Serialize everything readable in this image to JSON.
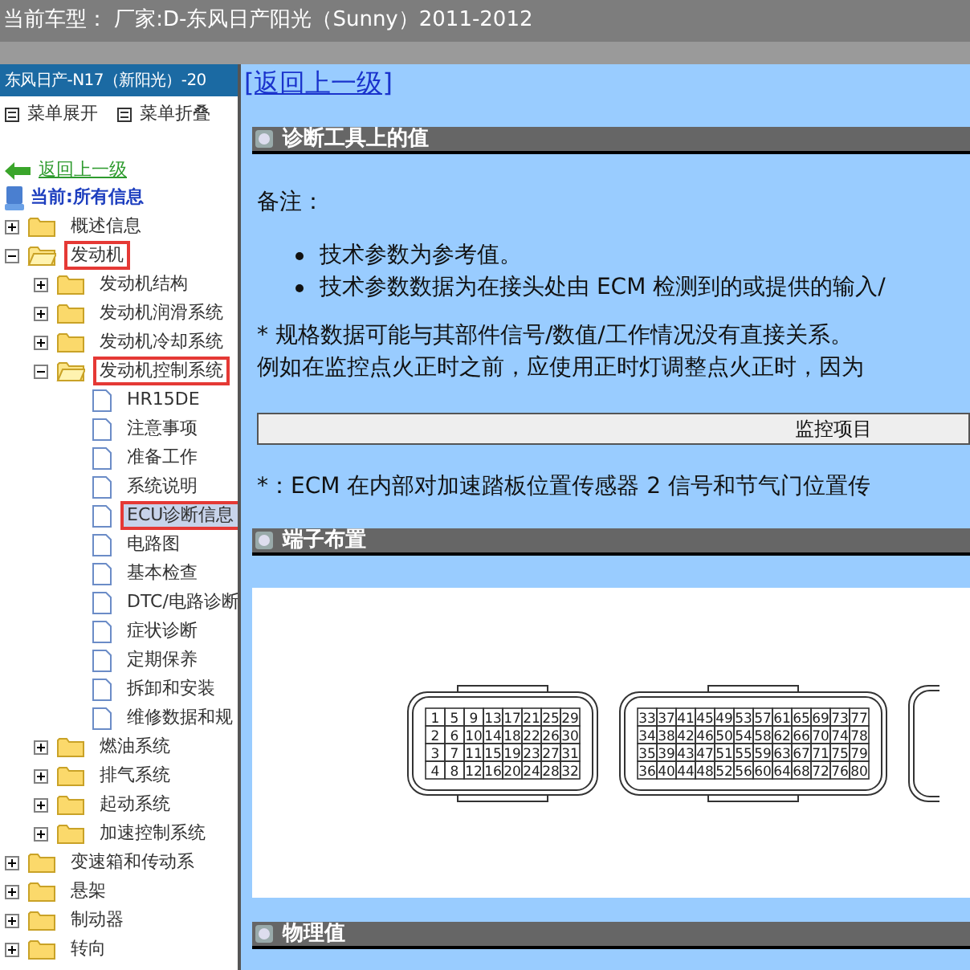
{
  "title_bar": {
    "text": "当前车型：  厂家:D-东风日产阳光（Sunny）2011-2012"
  },
  "sidebar": {
    "header": "东风日产-N17（新阳光）-20",
    "menu_buttons": [
      "菜单展开",
      "菜单折叠"
    ],
    "back_link": "返回上一级",
    "current": "当前:所有信息",
    "tree": [
      {
        "label": "概述信息",
        "kind": "folder",
        "expanded": false,
        "selected": false,
        "marked": false
      },
      {
        "label": "发动机",
        "kind": "folder",
        "expanded": true,
        "selected": false,
        "marked": true,
        "children": [
          {
            "label": "发动机结构",
            "kind": "folder",
            "expanded": false,
            "selected": false,
            "marked": false
          },
          {
            "label": "发动机润滑系统",
            "kind": "folder",
            "expanded": false,
            "selected": false,
            "marked": false
          },
          {
            "label": "发动机冷却系统",
            "kind": "folder",
            "expanded": false,
            "selected": false,
            "marked": false
          },
          {
            "label": "发动机控制系统",
            "kind": "folder",
            "expanded": true,
            "selected": false,
            "marked": true,
            "children": [
              {
                "label": "HR15DE",
                "kind": "page",
                "selected": false,
                "marked": false
              },
              {
                "label": "注意事项",
                "kind": "page",
                "selected": false,
                "marked": false
              },
              {
                "label": "准备工作",
                "kind": "page",
                "selected": false,
                "marked": false
              },
              {
                "label": "系统说明",
                "kind": "page",
                "selected": false,
                "marked": false
              },
              {
                "label": "ECU诊断信息",
                "kind": "page",
                "selected": true,
                "marked": true
              },
              {
                "label": "电路图",
                "kind": "page",
                "selected": false,
                "marked": false
              },
              {
                "label": "基本检查",
                "kind": "page",
                "selected": false,
                "marked": false
              },
              {
                "label": "DTC/电路诊断",
                "kind": "page",
                "selected": false,
                "marked": false
              },
              {
                "label": "症状诊断",
                "kind": "page",
                "selected": false,
                "marked": false
              },
              {
                "label": "定期保养",
                "kind": "page",
                "selected": false,
                "marked": false
              },
              {
                "label": "拆卸和安装",
                "kind": "page",
                "selected": false,
                "marked": false
              },
              {
                "label": "维修数据和规",
                "kind": "page",
                "selected": false,
                "marked": false
              }
            ]
          },
          {
            "label": "燃油系统",
            "kind": "folder",
            "expanded": false,
            "selected": false,
            "marked": false
          },
          {
            "label": "排气系统",
            "kind": "folder",
            "expanded": false,
            "selected": false,
            "marked": false
          },
          {
            "label": "起动系统",
            "kind": "folder",
            "expanded": false,
            "selected": false,
            "marked": false
          },
          {
            "label": "加速控制系统",
            "kind": "folder",
            "expanded": false,
            "selected": false,
            "marked": false
          }
        ]
      },
      {
        "label": "变速箱和传动系",
        "kind": "folder",
        "expanded": false,
        "selected": false,
        "marked": false
      },
      {
        "label": "悬架",
        "kind": "folder",
        "expanded": false,
        "selected": false,
        "marked": false
      },
      {
        "label": "制动器",
        "kind": "folder",
        "expanded": false,
        "selected": false,
        "marked": false
      },
      {
        "label": "转向",
        "kind": "folder",
        "expanded": false,
        "selected": false,
        "marked": false
      }
    ]
  },
  "content": {
    "back_link": "[返回上一级]",
    "sections": [
      {
        "kind": "notes",
        "heading": "诊断工具上的值",
        "note_label": "备注：",
        "bullets": [
          "技术参数为参考值。",
          "技术参数数据为在接头处由 ECM 检测到的或提供的输入/"
        ],
        "paragraphs": [
          "* 规格数据可能与其部件信号/数值/工作情况没有直接关系。",
          "例如在监控点火正时之前，应使用正时灯调整点火正时，因为"
        ],
        "table_header": "监控项目",
        "footnote": "*：ECM 在内部对加速踏板位置传感器 2 信号和节气门位置传"
      },
      {
        "kind": "connectors",
        "heading": "端子布置",
        "connectors": [
          {
            "rows": [
              [
                "1",
                "5",
                "9",
                "13",
                "17",
                "21",
                "25",
                "29"
              ],
              [
                "2",
                "6",
                "10",
                "14",
                "18",
                "22",
                "26",
                "30"
              ],
              [
                "3",
                "7",
                "11",
                "15",
                "19",
                "23",
                "27",
                "31"
              ],
              [
                "4",
                "8",
                "12",
                "16",
                "20",
                "24",
                "28",
                "32"
              ]
            ]
          },
          {
            "rows": [
              [
                "33",
                "37",
                "41",
                "45",
                "49",
                "53",
                "57",
                "61",
                "65",
                "69",
                "73",
                "77"
              ],
              [
                "34",
                "38",
                "42",
                "46",
                "50",
                "54",
                "58",
                "62",
                "66",
                "70",
                "74",
                "78"
              ],
              [
                "35",
                "39",
                "43",
                "47",
                "51",
                "55",
                "59",
                "63",
                "67",
                "71",
                "75",
                "79"
              ],
              [
                "36",
                "40",
                "44",
                "48",
                "52",
                "56",
                "60",
                "64",
                "68",
                "72",
                "76",
                "80"
              ]
            ]
          }
        ]
      },
      {
        "kind": "heading_only",
        "heading": "物理值"
      }
    ]
  }
}
